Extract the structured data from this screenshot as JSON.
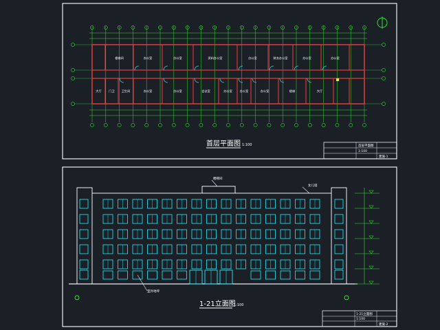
{
  "sheets": [
    {
      "title": "首层平面图",
      "scale": "1:100",
      "title_block": {
        "drawing_name": "首层平面图",
        "scale": "1:100",
        "drawing_no": "建施-1"
      }
    },
    {
      "title": "1-21立面图",
      "scale": "1:100",
      "title_block": {
        "drawing_name": "1-21立面图",
        "scale": "1:100",
        "drawing_no": "建施-2"
      }
    }
  ],
  "plan": {
    "rooms_top": [
      "楼梯间",
      "办公室",
      "办公室",
      "资料办公室",
      "办公室",
      "财务办公室",
      "办公室",
      "办公室"
    ],
    "rooms_bottom": [
      "大厅",
      "门卫",
      "卫生间",
      "办公室",
      "办公室",
      "会议室",
      "办公室",
      "办公室",
      "办公室",
      "楼梯",
      "大厅"
    ]
  },
  "elevation": {
    "labels": {
      "roof": "女儿墙",
      "stair_roof": "楼梯间",
      "ground": "室外地坪"
    }
  },
  "colors": {
    "background": "#1b1f26",
    "frame": "#e8eef5",
    "axis": "#2fe02f",
    "wall": "#e23b3b",
    "window": "#24d7e8",
    "text": "#ffffff",
    "accent": "#f3e33b"
  }
}
